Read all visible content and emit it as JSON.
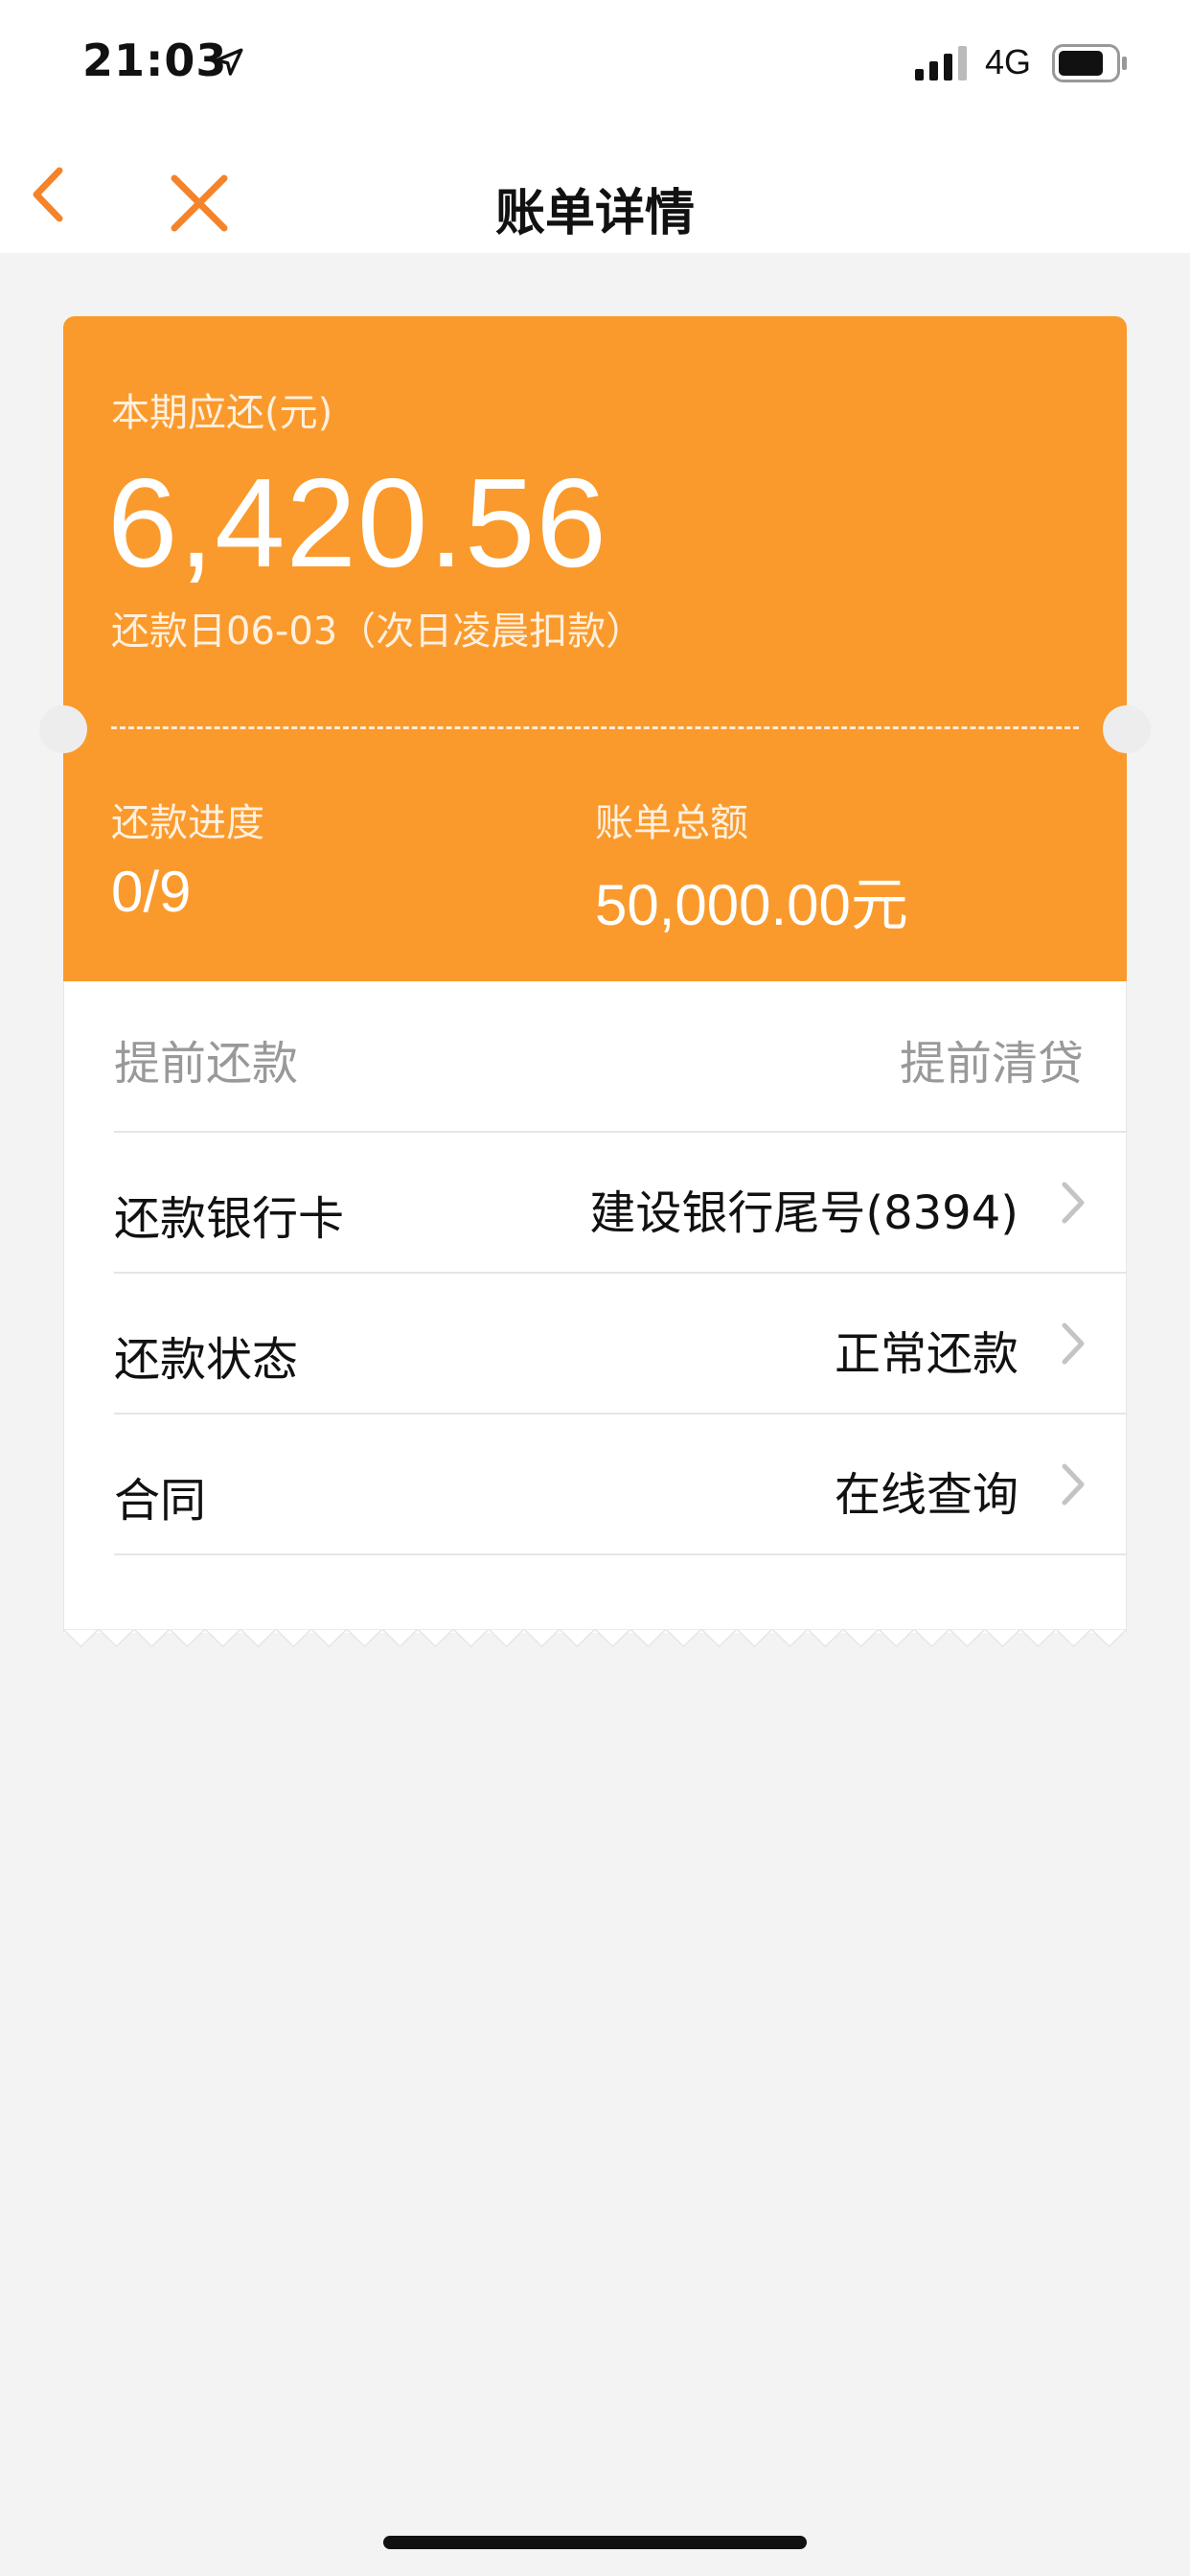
{
  "status_bar": {
    "time": "21:03",
    "network": "4G"
  },
  "nav": {
    "title": "账单详情"
  },
  "summary": {
    "due_label": "本期应还(元)",
    "due_amount": "6,420.56",
    "due_date": "还款日06-03（次日凌晨扣款）",
    "progress_label": "还款进度",
    "progress_value": "0/9",
    "total_label": "账单总额",
    "total_value": "50,000.00元"
  },
  "actions": {
    "prepay": "提前还款",
    "payoff": "提前清贷"
  },
  "rows": [
    {
      "label": "还款银行卡",
      "value": "建设银行尾号(8394)"
    },
    {
      "label": "还款状态",
      "value": "正常还款"
    },
    {
      "label": "合同",
      "value": "在线查询"
    }
  ],
  "colors": {
    "accent": "#fa9a2c",
    "nav_icon": "#f5832a",
    "background": "#f3f3f3"
  },
  "icons": {
    "back": "chevron-left-icon",
    "close": "close-icon",
    "row_arrow": "chevron-right-icon",
    "location": "location-arrow-icon",
    "signal": "signal-icon",
    "battery": "battery-icon"
  }
}
